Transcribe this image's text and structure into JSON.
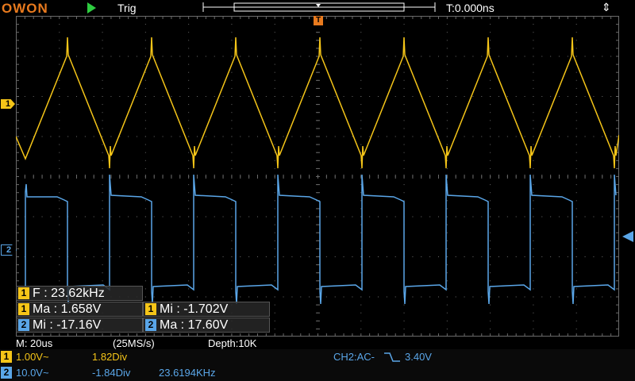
{
  "topbar": {
    "logo": "OWON",
    "run_state_icon": "play-icon",
    "trigger_status": "Trig",
    "time_offset": "T:0.000ns",
    "usb_icon": "usb-icon"
  },
  "markers": {
    "ch1": "1",
    "ch2": "2",
    "trigger_position": "T"
  },
  "measurements": {
    "freq": {
      "channel": "1",
      "text": "F : 23.62kHz"
    },
    "ch1_max": {
      "channel": "1",
      "text": "Ma : 1.658V"
    },
    "ch1_min": {
      "channel": "1",
      "text": "Mi : -1.702V"
    },
    "ch2_min": {
      "channel": "2",
      "text": "Mi : -17.16V"
    },
    "ch2_max": {
      "channel": "2",
      "text": "Ma : 17.60V"
    }
  },
  "acquisition": {
    "timebase": "M: 20us",
    "sample_rate": "(25MS/s)",
    "depth": "Depth:10K"
  },
  "channels": {
    "ch1": {
      "badge": "1",
      "scale": "1.00V~",
      "position": "1.82Div"
    },
    "ch2": {
      "badge": "2",
      "scale": "10.0V~",
      "position": "-1.84Div",
      "frequency": "23.6194KHz"
    }
  },
  "trigger": {
    "label": "CH2:AC-",
    "level": "3.40V"
  },
  "colors": {
    "ch1": "#f5c518",
    "ch2": "#5aa6e8",
    "logo": "#e87a1e",
    "grid": "#6a6a6a"
  }
}
